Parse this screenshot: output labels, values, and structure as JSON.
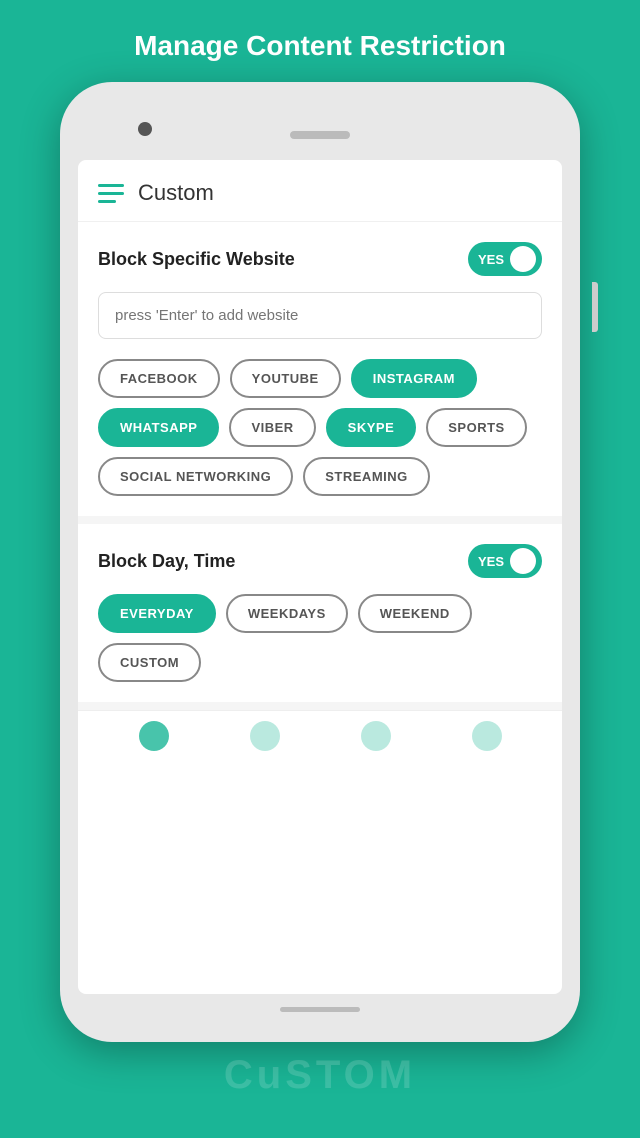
{
  "page": {
    "title": "Manage Content Restriction",
    "background_color": "#1ab596"
  },
  "app": {
    "header_title": "Custom",
    "hamburger_icon": "menu-icon"
  },
  "block_website": {
    "section_title": "Block Specific Website",
    "toggle_label": "YES",
    "toggle_state": true,
    "search_placeholder": "press 'Enter' to add website",
    "tags": [
      {
        "id": "facebook",
        "label": "FACEBOOK",
        "active": false
      },
      {
        "id": "youtube",
        "label": "YOUTUBE",
        "active": false
      },
      {
        "id": "instagram",
        "label": "INSTAGRAM",
        "active": true
      },
      {
        "id": "whatsapp",
        "label": "WHATSAPP",
        "active": true
      },
      {
        "id": "viber",
        "label": "VIBER",
        "active": false
      },
      {
        "id": "skype",
        "label": "SKYPE",
        "active": true
      },
      {
        "id": "sports",
        "label": "SPORTS",
        "active": false
      },
      {
        "id": "social_networking",
        "label": "SOCIAL NETWORKING",
        "active": false
      },
      {
        "id": "streaming",
        "label": "STREAMING",
        "active": false
      }
    ]
  },
  "block_time": {
    "section_title": "Block Day, Time",
    "toggle_label": "YES",
    "toggle_state": true,
    "tags": [
      {
        "id": "everyday",
        "label": "EVERYDAY",
        "active": true
      },
      {
        "id": "weekdays",
        "label": "WEEKDAYS",
        "active": false
      },
      {
        "id": "weekend",
        "label": "WEEKEND",
        "active": false
      },
      {
        "id": "custom",
        "label": "CUSTOM",
        "active": false
      }
    ]
  },
  "bottom_label": "CuSTOM"
}
